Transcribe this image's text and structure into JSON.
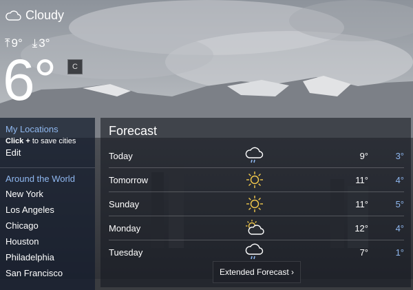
{
  "current": {
    "condition": "Cloudy",
    "condition_icon": "cloud-icon",
    "high": "9°",
    "low": "3°",
    "temp": "6°",
    "unit": "C"
  },
  "sidebar": {
    "my_locations": "My Locations",
    "hint_bold": "Click +",
    "hint_rest": " to save cities",
    "edit": "Edit",
    "around_world": "Around the World",
    "cities": [
      "New York",
      "Los Angeles",
      "Chicago",
      "Houston",
      "Philadelphia",
      "San Francisco"
    ]
  },
  "forecast": {
    "title": "Forecast",
    "days": [
      {
        "day": "Today",
        "icon": "rain-cloud-icon",
        "high": "9°",
        "low": "3°"
      },
      {
        "day": "Tomorrow",
        "icon": "sun-icon",
        "high": "11°",
        "low": "4°"
      },
      {
        "day": "Sunday",
        "icon": "sun-icon",
        "high": "11°",
        "low": "5°"
      },
      {
        "day": "Monday",
        "icon": "partly-cloudy-icon",
        "high": "12°",
        "low": "4°"
      },
      {
        "day": "Tuesday",
        "icon": "rain-cloud-icon",
        "high": "7°",
        "low": "1°"
      }
    ],
    "extended_label": "Extended Forecast ›"
  },
  "colors": {
    "accent_blue": "#8fb8f0",
    "sun_yellow": "#f2c94c"
  }
}
